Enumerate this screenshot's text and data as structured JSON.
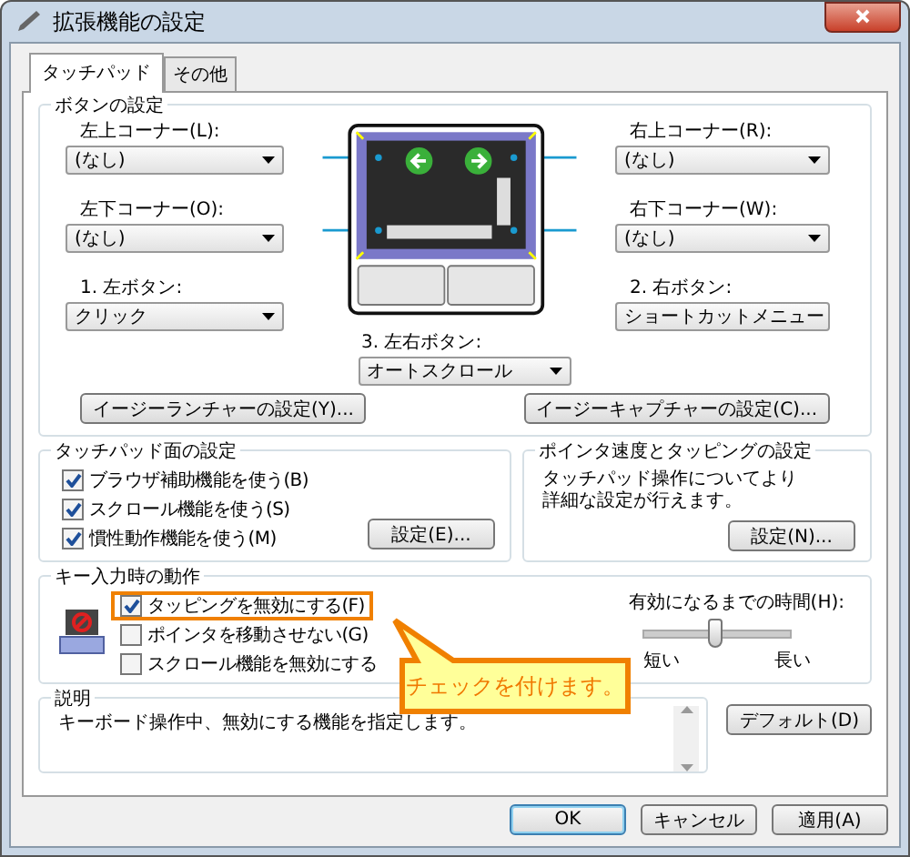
{
  "window": {
    "title": "拡張機能の設定"
  },
  "tabs": [
    {
      "label": "タッチパッド",
      "selected": true
    },
    {
      "label": "その他",
      "selected": false
    }
  ],
  "button_settings": {
    "title": "ボタンの設定",
    "left": [
      {
        "label": "左上コーナー(L):",
        "value": "(なし)"
      },
      {
        "label": "左下コーナー(O):",
        "value": "(なし)"
      },
      {
        "label": "1. 左ボタン:",
        "value": "クリック"
      }
    ],
    "right": [
      {
        "label": "右上コーナー(R):",
        "value": "(なし)"
      },
      {
        "label": "右下コーナー(W):",
        "value": "(なし)"
      },
      {
        "label": "2. 右ボタン:",
        "value": "ショートカットメニュー"
      }
    ],
    "both": {
      "label": "3. 左右ボタン:",
      "value": "オートスクロール"
    },
    "buttons": [
      "イージーランチャーの設定(Y)...",
      "イージーキャプチャーの設定(C)..."
    ]
  },
  "touchpad_surface": {
    "title": "タッチパッド面の設定",
    "options": [
      {
        "label": "ブラウザ補助機能を使う(B)",
        "checked": true
      },
      {
        "label": "スクロール機能を使う(S)",
        "checked": true
      },
      {
        "label": "慣性動作機能を使う(M)",
        "checked": true
      }
    ],
    "button": "設定(E)..."
  },
  "pointer_tapping": {
    "title": "ポインタ速度とタッピングの設定",
    "text": "タッチパッド操作についてより詳細な設定が行えます。",
    "button": "設定(N)..."
  },
  "key_input": {
    "title": "キー入力時の動作",
    "options": [
      {
        "label": "タッピングを無効にする(F)",
        "checked": true,
        "highlighted": true
      },
      {
        "label": "ポインタを移動させない(G)",
        "checked": false,
        "highlighted": false
      },
      {
        "label": "スクロール機能を無効にする",
        "checked": false,
        "highlighted": false
      }
    ],
    "delay": {
      "label": "有効になるまでの時間(H):",
      "level": 0.48,
      "min_label": "短い",
      "max_label": "長い"
    }
  },
  "description": {
    "title": "説明",
    "text": "キーボード操作中、無効にする機能を指定します。"
  },
  "default_button": "デフォルト(D)",
  "callout": {
    "text": "チェックを付けます。"
  },
  "buttons": [
    {
      "label": "OK",
      "default": true
    },
    {
      "label": "キャンセル",
      "default": false
    },
    {
      "label": "適用(A)",
      "default": false
    }
  ]
}
